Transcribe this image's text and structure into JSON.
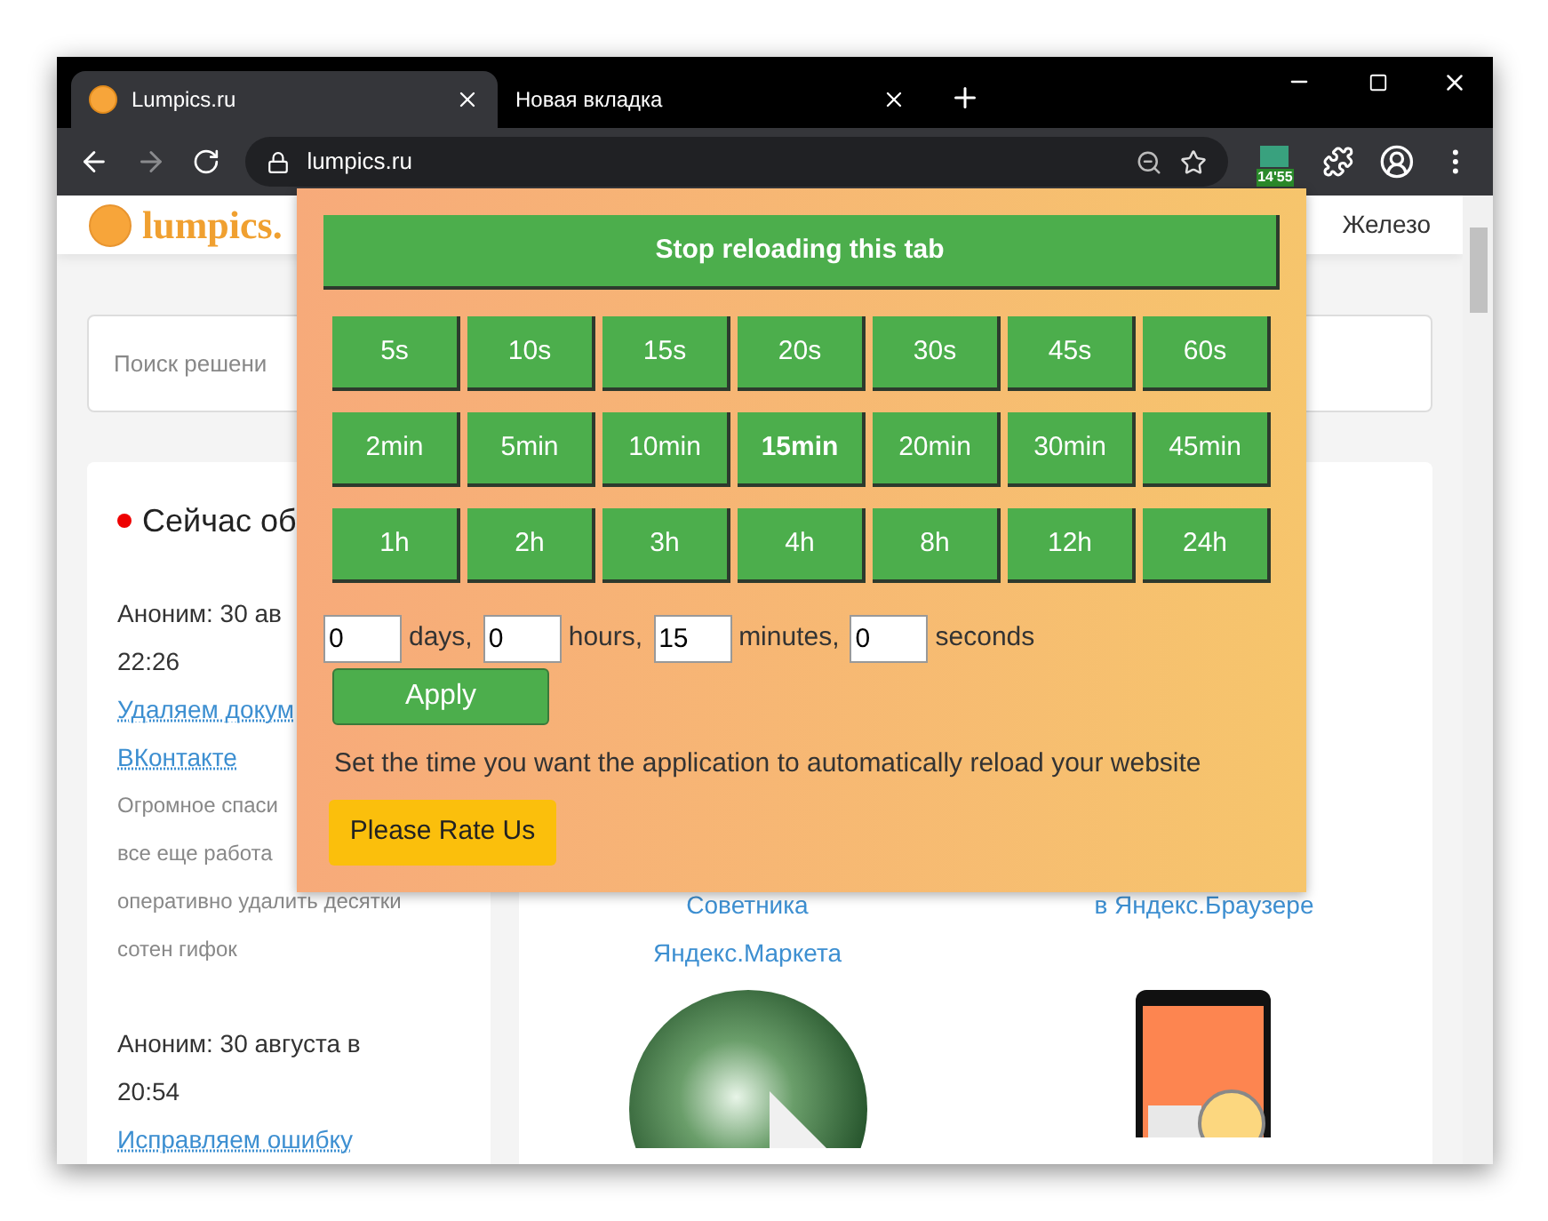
{
  "browser": {
    "tabs": [
      {
        "title": "Lumpics.ru",
        "selected": true
      },
      {
        "title": "Новая вкладка",
        "selected": false
      }
    ],
    "address": "lumpics.ru",
    "extension_badge": "14'55"
  },
  "site": {
    "logo": "lumpics.",
    "nav_item": "Железо",
    "search_placeholder": "Поиск решени",
    "sidebar": {
      "heading": "Сейчас об",
      "comments": [
        {
          "lines": [
            {
              "kind": "meta",
              "text": "Аноним: 30 ав"
            },
            {
              "kind": "meta",
              "text": "22:26"
            },
            {
              "kind": "link",
              "text": "Удаляем докум"
            },
            {
              "kind": "link",
              "text": "ВКонтакте"
            },
            {
              "kind": "excerpt",
              "text": "Огромное спаси"
            },
            {
              "kind": "excerpt",
              "text": "все еще работа"
            },
            {
              "kind": "excerpt",
              "text": "оперативно удалить десятки"
            },
            {
              "kind": "excerpt",
              "text": "сотен гифок"
            }
          ]
        },
        {
          "lines": [
            {
              "kind": "meta",
              "text": "Аноним: 30 августа в"
            },
            {
              "kind": "meta",
              "text": "20:54"
            },
            {
              "kind": "link",
              "text": "Исправляем ошибку"
            }
          ]
        }
      ]
    },
    "articles": [
      {
        "title_lines": [
          "Советника",
          "Яндекс.Маркета"
        ],
        "kind": "globe"
      },
      {
        "title_lines": [
          "в Яндекс.Браузере"
        ],
        "kind": "phone"
      }
    ]
  },
  "popup": {
    "stop_button": "Stop reloading this tab",
    "intervals": [
      [
        {
          "label": "5s",
          "selected": false
        },
        {
          "label": "10s",
          "selected": false
        },
        {
          "label": "15s",
          "selected": false
        },
        {
          "label": "20s",
          "selected": false
        },
        {
          "label": "30s",
          "selected": false
        },
        {
          "label": "45s",
          "selected": false
        },
        {
          "label": "60s",
          "selected": false
        }
      ],
      [
        {
          "label": "2min",
          "selected": false
        },
        {
          "label": "5min",
          "selected": false
        },
        {
          "label": "10min",
          "selected": false
        },
        {
          "label": "15min",
          "selected": true
        },
        {
          "label": "20min",
          "selected": false
        },
        {
          "label": "30min",
          "selected": false
        },
        {
          "label": "45min",
          "selected": false
        }
      ],
      [
        {
          "label": "1h",
          "selected": false
        },
        {
          "label": "2h",
          "selected": false
        },
        {
          "label": "3h",
          "selected": false
        },
        {
          "label": "4h",
          "selected": false
        },
        {
          "label": "8h",
          "selected": false
        },
        {
          "label": "12h",
          "selected": false
        },
        {
          "label": "24h",
          "selected": false
        }
      ]
    ],
    "custom_fields": [
      {
        "value": "0",
        "unit": "days,"
      },
      {
        "value": "0",
        "unit": "hours,"
      },
      {
        "value": "15",
        "unit": "minutes,"
      },
      {
        "value": "0",
        "unit": "seconds"
      }
    ],
    "apply_button": "Apply",
    "hint": "Set the time you want the application to automatically reload your website",
    "rate_button": "Please Rate Us"
  }
}
